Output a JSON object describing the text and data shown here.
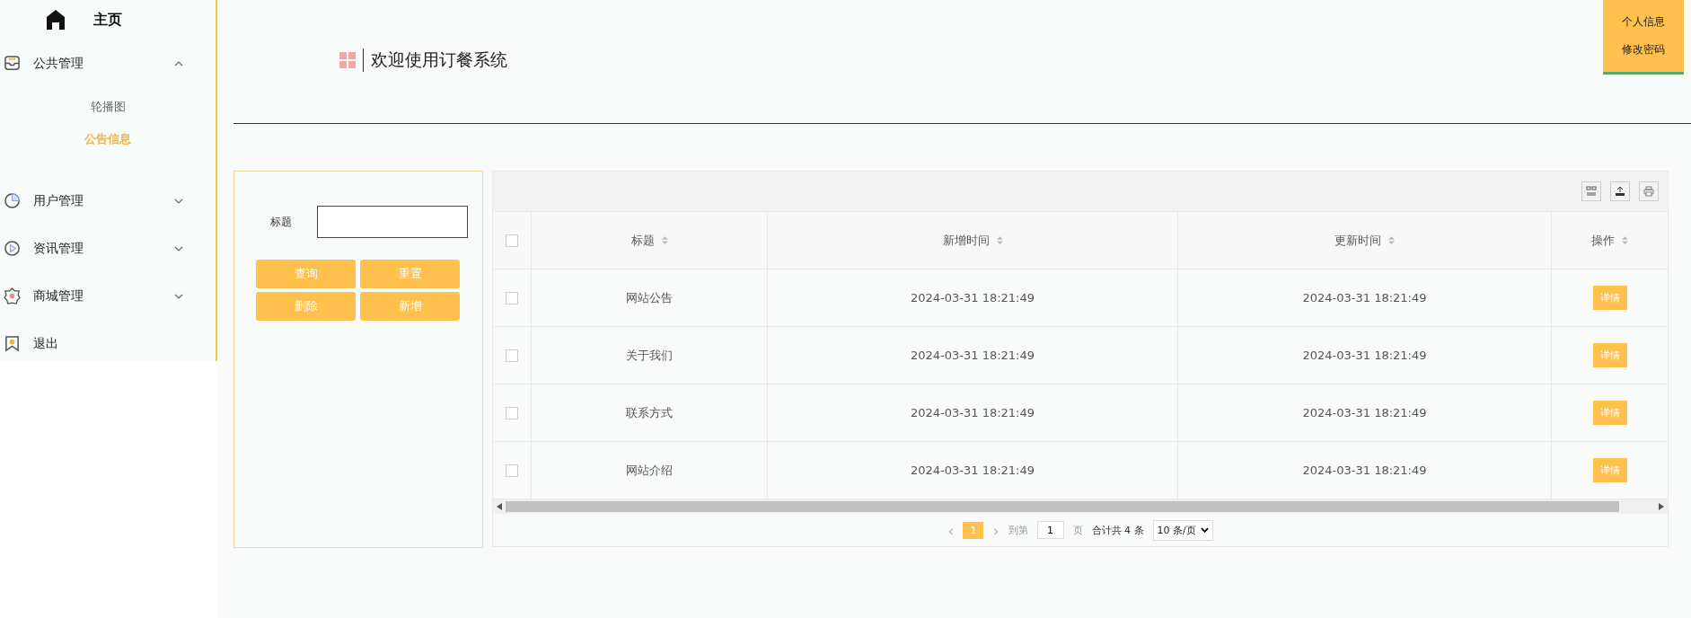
{
  "sidebar": {
    "home": "主页",
    "items": [
      {
        "label": "公共管理",
        "expanded": true,
        "children": [
          {
            "label": "轮播图",
            "selected": false
          },
          {
            "label": "公告信息",
            "selected": true
          }
        ]
      },
      {
        "label": "用户管理",
        "expanded": false
      },
      {
        "label": "资讯管理",
        "expanded": false
      },
      {
        "label": "商城管理",
        "expanded": false
      },
      {
        "label": "退出"
      }
    ]
  },
  "header": {
    "title": "欢迎使用订餐系统",
    "user_menu": [
      "个人信息",
      "修改密码"
    ]
  },
  "search": {
    "label": "标题",
    "buttons": [
      "查询",
      "重置",
      "删除",
      "新增"
    ]
  },
  "table": {
    "select_all_checked": false,
    "columns": [
      "标题",
      "新增时间",
      "更新时间",
      "操作"
    ],
    "rows": [
      {
        "checked": false,
        "cells": [
          "网站公告",
          "2024-03-31 18:21:49",
          "2024-03-31 18:21:49"
        ],
        "action": "详情"
      },
      {
        "checked": false,
        "cells": [
          "关于我们",
          "2024-03-31 18:21:49",
          "2024-03-31 18:21:49"
        ],
        "action": "详情"
      },
      {
        "checked": false,
        "cells": [
          "联系方式",
          "2024-03-31 18:21:49",
          "2024-03-31 18:21:49"
        ],
        "action": "详情"
      },
      {
        "checked": false,
        "cells": [
          "网站介绍",
          "2024-03-31 18:21:49",
          "2024-03-31 18:21:49"
        ],
        "action": "详情"
      }
    ]
  },
  "pagination": {
    "prev": "‹",
    "pages": [
      {
        "label": "1",
        "selected": true
      }
    ],
    "next": "›",
    "goto_label": "到第",
    "goto_value": "1",
    "page_suffix": "页",
    "total": "合计共 4 条",
    "page_size": "10 条/页"
  }
}
